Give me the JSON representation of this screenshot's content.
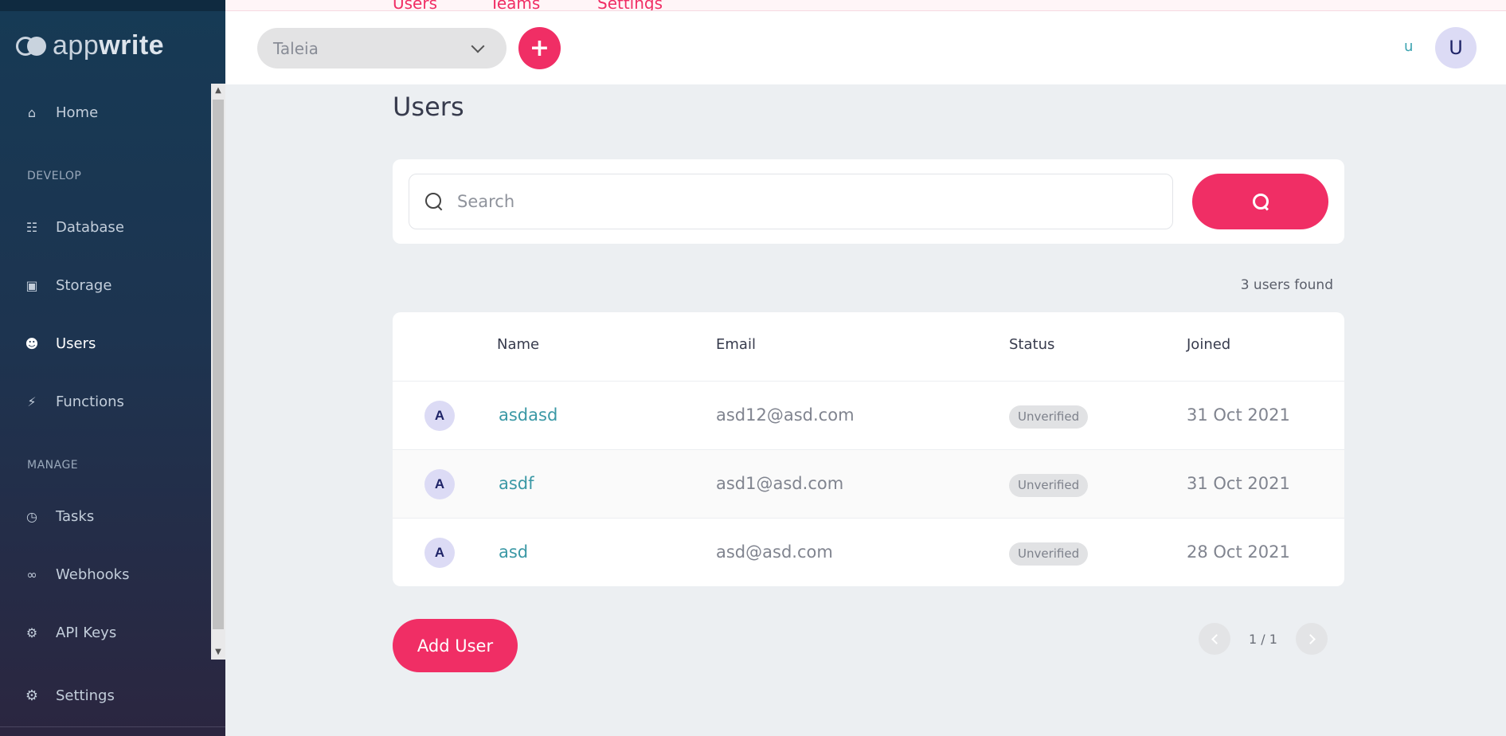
{
  "app": {
    "logo_light": "app",
    "logo_bold": "write"
  },
  "header": {
    "tabs": [
      {
        "label": "Users",
        "active": true
      },
      {
        "label": "Teams",
        "active": false
      },
      {
        "label": "Settings",
        "active": false
      }
    ],
    "project": "Taleia",
    "user_initial": "u",
    "avatar_initial": "U"
  },
  "sidebar": {
    "home": {
      "label": "Home",
      "icon": "home-icon"
    },
    "develop_label": "DEVELOP",
    "develop": [
      {
        "label": "Database",
        "icon": "database-icon"
      },
      {
        "label": "Storage",
        "icon": "folder-icon"
      },
      {
        "label": "Users",
        "icon": "users-icon",
        "active": true
      },
      {
        "label": "Functions",
        "icon": "bolt-icon"
      }
    ],
    "manage_label": "MANAGE",
    "manage": [
      {
        "label": "Tasks",
        "icon": "clock-icon"
      },
      {
        "label": "Webhooks",
        "icon": "link-icon"
      },
      {
        "label": "API Keys",
        "icon": "key-icon"
      }
    ],
    "settings": {
      "label": "Settings",
      "icon": "gear-icon"
    }
  },
  "main": {
    "title": "Users",
    "search": {
      "placeholder": "Search",
      "value": ""
    },
    "users_found": "3 users found",
    "table": {
      "columns": [
        "Name",
        "Email",
        "Status",
        "Joined"
      ],
      "rows": [
        {
          "initial": "A",
          "name": "asdasd",
          "email": "asd12@asd.com",
          "status": "Unverified",
          "joined": "31 Oct 2021"
        },
        {
          "initial": "A",
          "name": "asdf",
          "email": "asd1@asd.com",
          "status": "Unverified",
          "joined": "31 Oct 2021"
        },
        {
          "initial": "A",
          "name": "asd",
          "email": "asd@asd.com",
          "status": "Unverified",
          "joined": "28 Oct 2021"
        }
      ]
    },
    "add_user_label": "Add User",
    "pagination": "1 / 1"
  },
  "colors": {
    "accent": "#f02e65",
    "link": "#3a98a5",
    "sidebar_top": "#163a55",
    "sidebar_bottom": "#2b2640"
  }
}
